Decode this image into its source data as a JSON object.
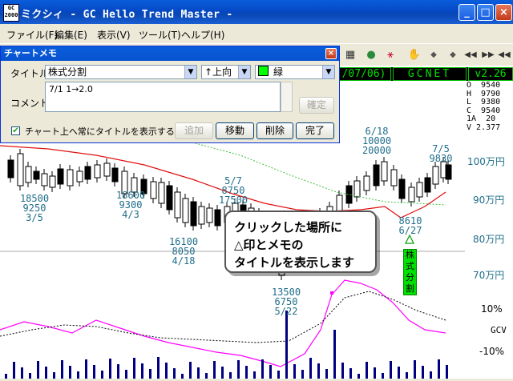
{
  "window": {
    "icon_text_top": "GC",
    "icon_text_bottom": "2000",
    "title": "ミクシィ - GC Hello Trend Master -",
    "minimize": "_",
    "maximize": "□",
    "close": "×"
  },
  "menu": [
    {
      "label": "ファイル(F)"
    },
    {
      "label": "編集(E)"
    },
    {
      "label": "表示(V)"
    },
    {
      "label": "ツール(T)"
    },
    {
      "label": "ヘルプ(H)"
    }
  ],
  "toolbar_glyphs": [
    "▦",
    "●",
    "⚹",
    "✋",
    "◆",
    "◆",
    "◀◀",
    "▶▶",
    "◀◀"
  ],
  "datebar": {
    "date": "/07/06)",
    "code": "GCNET",
    "version": "v2.26"
  },
  "ohlc_text": "O  9540\nH  9790\nL  9380\nC  9540\n1A  20\nV 2.377",
  "price_axis": [
    "100万円",
    "90万円",
    "80万円",
    "70万円"
  ],
  "osc_axis": [
    "10%",
    "GCV",
    "-10%"
  ],
  "annotations": [
    {
      "text": "6/18\n10000\n20000"
    },
    {
      "text": "7/5\n9830"
    },
    {
      "text": "5/7\n8750\n17500"
    },
    {
      "text": "18500\n9250\n3/5"
    },
    {
      "text": "18600\n9300\n4/3"
    },
    {
      "text": "16100\n8050\n4/18"
    },
    {
      "text": "8610\n6/27"
    },
    {
      "text": "13500\n6750\n5/22"
    }
  ],
  "memo_dialog": {
    "title": "チャートメモ",
    "close": "×",
    "title_label": "タイトル",
    "title_value": "株式分割",
    "direction_value": "↑上向",
    "color_value": "緑",
    "comment_label": "コメント",
    "comment_value": "7/1  1→2.0",
    "confirm": "確定",
    "show_title_checkbox": "チャート上へ常にタイトルを表示する",
    "add": "追加",
    "move": "移動",
    "delete": "削除",
    "done": "完了"
  },
  "callout": {
    "line1": "クリックした場所に",
    "line2": "△印とメモの",
    "line3": "タイトルを表示します"
  },
  "split_marker_text": "株式分割",
  "colors": {
    "titlebar": "#0a5ddc",
    "price_ma_short": "#e01010",
    "price_ma_long": "#40c040",
    "osc_magenta": "#ff00ff",
    "osc_black": "#000000",
    "volume_bars": "#000080",
    "split_label": "#00e000"
  }
}
